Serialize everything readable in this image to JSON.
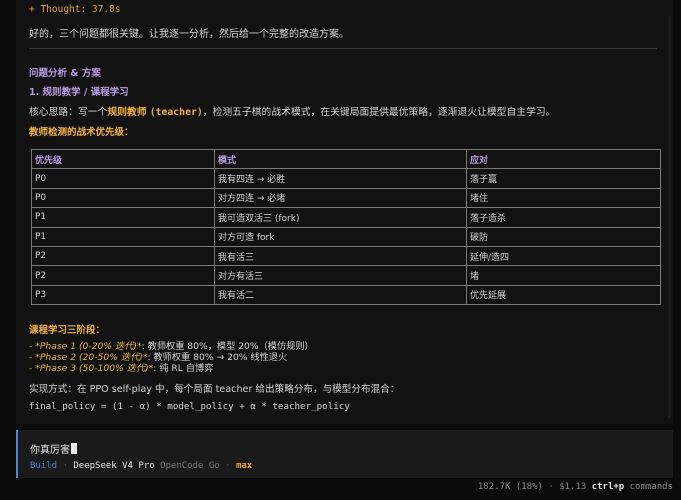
{
  "thought": "+ Thought: 37.8s",
  "intro": "好的，三个问题都很关键。让我逐一分析，然后给一个完整的改造方案。",
  "section_title": "问题分析 & 方案",
  "subsection_title": "1. 规则教学 / 课程学习",
  "core_idea": {
    "prefix": "核心思路：写一个",
    "highlight": "规则教师",
    "highlight_mono": "(teacher)",
    "suffix": "，检测五子棋的战术模式，在关键局面提供最优策略，逐渐退火让模型自主学习。"
  },
  "teacher_heading": "教师检测的战术优先级：",
  "table": {
    "headers": [
      "优先级",
      "模式",
      "应对"
    ],
    "rows": [
      [
        "P0",
        "我有四连 → 必胜",
        "落子赢"
      ],
      [
        "P0",
        "对方四连 → 必堵",
        "堵住"
      ],
      [
        "P1",
        "我可造双活三 (fork)",
        "落子造杀"
      ],
      [
        "P1",
        "对方可造 fork",
        "破防"
      ],
      [
        "P2",
        "我有活三",
        "延伸/造四"
      ],
      [
        "P2",
        "对方有活三",
        "堵"
      ],
      [
        "P3",
        "我有活二",
        "优先延展"
      ]
    ]
  },
  "curriculum_heading": "课程学习三阶段：",
  "phases": [
    {
      "dash": "- ",
      "name": "*Phase 1 (0-20% 迭代)*",
      "desc": ": 教师权重 80%，模型 20%（模仿规则）"
    },
    {
      "dash": "- ",
      "name": "*Phase 2 (20-50% 迭代)*",
      "desc": ": 教师权重 80% → 20% 线性退火"
    },
    {
      "dash": "- ",
      "name": "*Phase 3 (50-100% 迭代)*",
      "desc": ": 纯 RL 自博弈"
    }
  ],
  "implementation": "实现方式：在 PPO self-play 中，每个局面 teacher 给出策略分布，与模型分布混合：",
  "code": "final_policy = (1 - α) * model_policy + α * teacher_policy",
  "prompt": {
    "input_value": "你真厉害",
    "mode": "Build",
    "separator": "·",
    "model": "DeepSeek V4 Pro",
    "provider": "OpenCode Go",
    "variant": "max"
  },
  "status": {
    "tokens": "182.7K (18%)",
    "cost": "$1.13",
    "shortcut": "ctrl+p",
    "shortcut_label": "commands"
  },
  "colors": {
    "accent_orange": "#f0b04a",
    "accent_purple": "#b69ae0",
    "accent_blue": "#4f86d6"
  }
}
